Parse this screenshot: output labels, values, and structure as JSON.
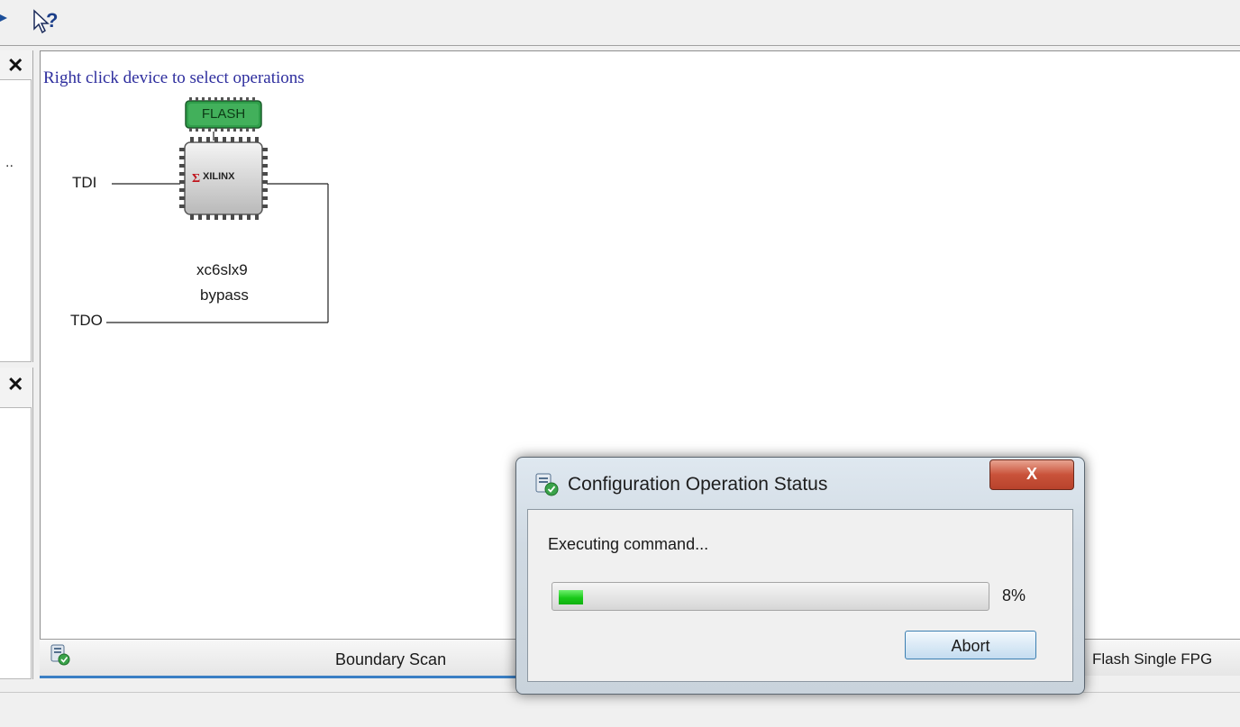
{
  "toolbar": {
    "icons": [
      "arrow-icon",
      "help-pointer-icon"
    ]
  },
  "canvas": {
    "hint": "Right click device to select operations",
    "tdi_label": "TDI",
    "tdo_label": "TDO",
    "flash_label": "FLASH",
    "chip_logo": "XILINX",
    "device_name": "xc6slx9",
    "device_mode": "bypass"
  },
  "left_panel": {
    "close_glyph": "✕",
    "truncated_text": ".."
  },
  "tabs": [
    {
      "label": "Boundary Scan",
      "active": true
    },
    {
      "label": "Flash Single FPG",
      "active": false
    }
  ],
  "dialog": {
    "title": "Configuration Operation Status",
    "close_glyph": "X",
    "message": "Executing command...",
    "progress": 8,
    "progress_text": "8%",
    "abort_label": "Abort"
  },
  "colors": {
    "hint": "#2e2e9e",
    "progress": "#19c919",
    "flash_chip": "#2f9e4a",
    "tab_accent": "#3b7fc4"
  }
}
